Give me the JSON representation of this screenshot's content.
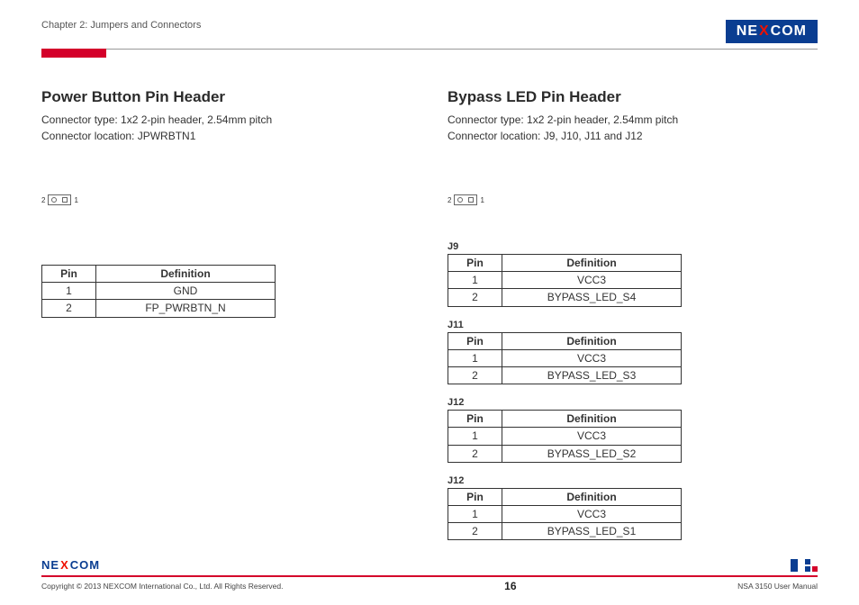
{
  "header": {
    "chapter": "Chapter 2: Jumpers and Connectors",
    "brand_pre": "NE",
    "brand_x": "X",
    "brand_post": "COM"
  },
  "left": {
    "title": "Power Button Pin Header",
    "line1": "Connector type: 1x2 2-pin header, 2.54mm pitch",
    "line2": "Connector location: JPWRBTN1",
    "pin_left": "2",
    "pin_right": "1",
    "th_pin": "Pin",
    "th_def": "Definition",
    "rows": [
      {
        "pin": "1",
        "def": "GND"
      },
      {
        "pin": "2",
        "def": "FP_PWRBTN_N"
      }
    ]
  },
  "right": {
    "title": "Bypass LED Pin Header",
    "line1": "Connector type: 1x2 2-pin header, 2.54mm pitch",
    "line2": "Connector location: J9, J10, J11 and J12",
    "pin_left": "2",
    "pin_right": "1",
    "th_pin": "Pin",
    "th_def": "Definition",
    "tables": [
      {
        "label": "J9",
        "rows": [
          {
            "pin": "1",
            "def": "VCC3"
          },
          {
            "pin": "2",
            "def": "BYPASS_LED_S4"
          }
        ]
      },
      {
        "label": "J11",
        "rows": [
          {
            "pin": "1",
            "def": "VCC3"
          },
          {
            "pin": "2",
            "def": "BYPASS_LED_S3"
          }
        ]
      },
      {
        "label": "J12",
        "rows": [
          {
            "pin": "1",
            "def": "VCC3"
          },
          {
            "pin": "2",
            "def": "BYPASS_LED_S2"
          }
        ]
      },
      {
        "label": "J12",
        "rows": [
          {
            "pin": "1",
            "def": "VCC3"
          },
          {
            "pin": "2",
            "def": "BYPASS_LED_S1"
          }
        ]
      }
    ]
  },
  "footer": {
    "brand_pre": "NE",
    "brand_x": "X",
    "brand_post": "COM",
    "copyright": "Copyright © 2013 NEXCOM International Co., Ltd. All Rights Reserved.",
    "page": "16",
    "manual": "NSA 3150 User Manual"
  }
}
